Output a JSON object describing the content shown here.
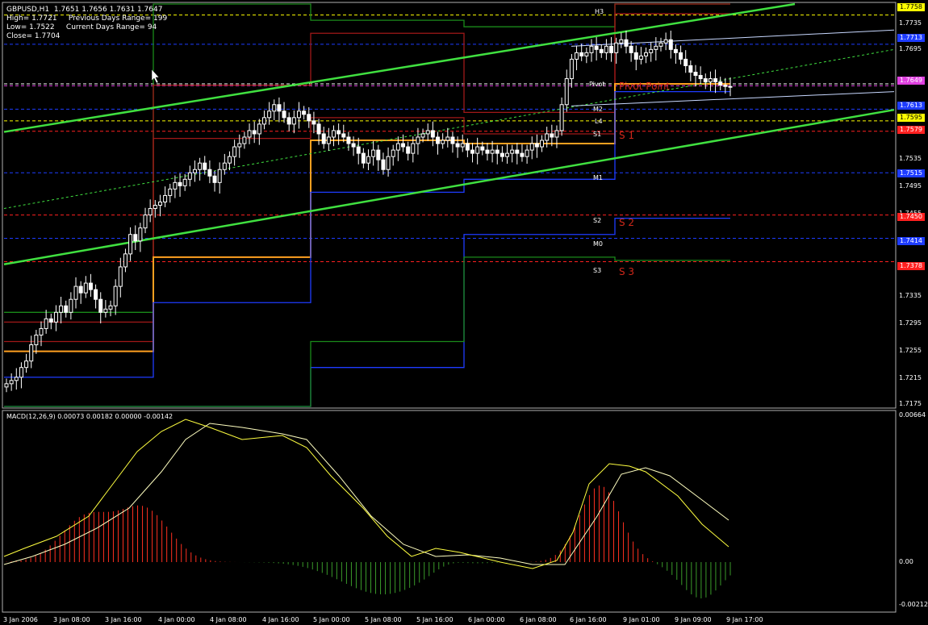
{
  "info": {
    "line1": "GBPUSD,H1  1.7651 1.7656 1.7631 1.7647",
    "line2": "High= 1.7721     Previous Days Range= 199",
    "line3": "Low= 1.7522     Current Days Range= 94",
    "line4": "Close= 1.7704"
  },
  "price_axis": {
    "ticks": [
      "1.7735",
      "1.7695",
      "1.7535",
      "1.7495",
      "1.7455",
      "1.7335",
      "1.7295",
      "1.7255",
      "1.7215",
      "1.7175"
    ],
    "boxes": [
      {
        "text": "1.7758",
        "color": "#ffff00"
      },
      {
        "text": "1.7713",
        "color": "#1e3cff"
      },
      {
        "text": "1.7649",
        "color": "#e040e0"
      },
      {
        "text": "1.7613",
        "color": "#1e3cff"
      },
      {
        "text": "1.7595",
        "color": "#ffff00"
      },
      {
        "text": "1.7579",
        "color": "#ff2020"
      },
      {
        "text": "1.7515",
        "color": "#1e3cff"
      },
      {
        "text": "1.7450",
        "color": "#ff2020"
      },
      {
        "text": "1.7414",
        "color": "#1e3cff"
      },
      {
        "text": "1.7378",
        "color": "#ff2020"
      }
    ]
  },
  "levels": {
    "h3": "H3",
    "pivot": "Pivot",
    "m2": "M2",
    "l4": "L4",
    "s1": "S1",
    "m1": "M1",
    "s2": "S2",
    "m0": "M0",
    "s3": "S3",
    "pivot_point": "Pivot Point",
    "s1_big": "S 1",
    "s2_big": "S 2",
    "s3_big": "S 3"
  },
  "macd": {
    "label": "MACD(12,26,9) 0.00073 0.00182 0.00000 -0.00142",
    "ticks": [
      "0.00664",
      "0.00",
      "-0.00212"
    ]
  },
  "time_axis": [
    "3 Jan 2006",
    "3 Jan 08:00",
    "3 Jan 16:00",
    "4 Jan 00:00",
    "4 Jan 08:00",
    "4 Jan 16:00",
    "5 Jan 00:00",
    "5 Jan 08:00",
    "5 Jan 16:00",
    "6 Jan 00:00",
    "6 Jan 08:00",
    "6 Jan 16:00",
    "9 Jan 01:00",
    "9 Jan 09:00",
    "9 Jan 17:00"
  ],
  "chart_data": {
    "type": "candlestick",
    "symbol": "GBPUSD",
    "timeframe": "H1",
    "ylim": [
      1.7155,
      1.7775
    ],
    "closes": [
      1.719,
      1.7195,
      1.72,
      1.7215,
      1.7225,
      1.725,
      1.7265,
      1.7275,
      1.729,
      1.7285,
      1.73,
      1.731,
      1.73,
      1.732,
      1.734,
      1.733,
      1.7345,
      1.7335,
      1.732,
      1.73,
      1.7305,
      1.731,
      1.734,
      1.737,
      1.739,
      1.742,
      1.741,
      1.743,
      1.745,
      1.746,
      1.7465,
      1.747,
      1.748,
      1.749,
      1.75,
      1.7495,
      1.7505,
      1.7515,
      1.752,
      1.753,
      1.752,
      1.751,
      1.75,
      1.752,
      1.753,
      1.754,
      1.7555,
      1.756,
      1.757,
      1.758,
      1.7575,
      1.759,
      1.76,
      1.761,
      1.762,
      1.761,
      1.76,
      1.759,
      1.76,
      1.761,
      1.7605,
      1.7595,
      1.759,
      1.7575,
      1.756,
      1.757,
      1.758,
      1.7575,
      1.757,
      1.756,
      1.7555,
      1.7545,
      1.753,
      1.754,
      1.755,
      1.7535,
      1.752,
      1.754,
      1.755,
      1.756,
      1.7555,
      1.7545,
      1.756,
      1.757,
      1.7575,
      1.758,
      1.757,
      1.756,
      1.7565,
      1.757,
      1.756,
      1.7555,
      1.756,
      1.755,
      1.7545,
      1.7555,
      1.755,
      1.7545,
      1.755,
      1.7545,
      1.754,
      1.7545,
      1.755,
      1.7545,
      1.754,
      1.755,
      1.756,
      1.7555,
      1.7565,
      1.7575,
      1.757,
      1.758,
      1.762,
      1.766,
      1.769,
      1.77,
      1.7695,
      1.77,
      1.771,
      1.7705,
      1.77,
      1.771,
      1.77,
      1.7715,
      1.772,
      1.771,
      1.77,
      1.769,
      1.7695,
      1.77,
      1.7705,
      1.771,
      1.7715,
      1.772,
      1.7705,
      1.77,
      1.769,
      1.768,
      1.767,
      1.7665,
      1.766,
      1.7655,
      1.766,
      1.7655,
      1.765,
      1.7648,
      1.7647
    ]
  }
}
